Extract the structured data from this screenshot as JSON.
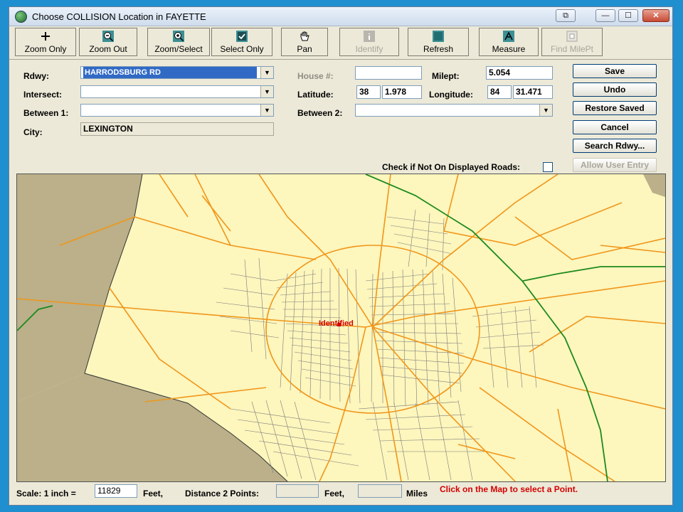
{
  "window": {
    "title": "Choose COLLISION Location in FAYETTE"
  },
  "title_buttons": {
    "restore": "⧉",
    "minimize": "—",
    "maximize": "☐",
    "close": "✕"
  },
  "toolbar": {
    "zoom_only": "Zoom Only",
    "zoom_out": "Zoom Out",
    "zoom_select": "Zoom/Select",
    "select_only": "Select Only",
    "pan": "Pan",
    "identify": "Identify",
    "refresh": "Refresh",
    "measure": "Measure",
    "find_milept": "Find MilePt"
  },
  "form": {
    "rdwy_label": "Rdwy:",
    "rdwy_value": "HARRODSBURG RD",
    "intersect_label": "Intersect:",
    "intersect_value": "",
    "between1_label": "Between 1:",
    "between1_value": "",
    "city_label": "City:",
    "city_value": "LEXINGTON",
    "house_label": "House #:",
    "house_value": "",
    "milept_label": "Milept:",
    "milept_value": "5.054",
    "latitude_label": "Latitude:",
    "lat_deg": "38",
    "lat_min": "1.978",
    "longitude_label": "Longitude:",
    "lon_deg": "84",
    "lon_min": "31.471",
    "between2_label": "Between 2:",
    "between2_value": "",
    "check_label": "Check if Not On Displayed Roads:"
  },
  "buttons": {
    "save": "Save",
    "undo": "Undo",
    "restore_saved": "Restore Saved",
    "cancel": "Cancel",
    "search_rdwy": "Search Rdwy...",
    "allow_user_entry": "Allow User Entry"
  },
  "map": {
    "marker_label": "Identified",
    "colors": {
      "county_fill": "#fdf6bd",
      "outside_fill": "#bbb089",
      "major_road": "#f0961a",
      "interstate": "#1d8a1d",
      "local_road": "#7a7a7a",
      "marker": "#d40000"
    }
  },
  "status": {
    "scale_label": "Scale: 1 inch =",
    "scale_value": "11829",
    "feet_label": "Feet,",
    "distance_label": "Distance 2 Points:",
    "distance_value": "",
    "feet_label2": "Feet,",
    "miles_value": "",
    "miles_label": "Miles",
    "hint": "Click on the Map to select a Point."
  }
}
